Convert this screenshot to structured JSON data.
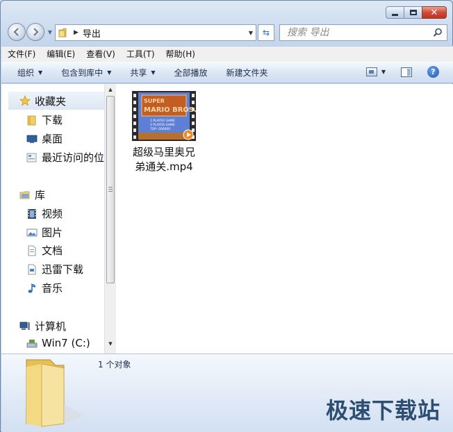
{
  "window": {
    "caption": {
      "minimize": "–",
      "maximize": "",
      "close": "✕"
    }
  },
  "address": {
    "path": "导出",
    "refresh_icon": "refresh-icon"
  },
  "search": {
    "placeholder": "搜索 导出"
  },
  "menu": {
    "items": [
      "文件(F)",
      "编辑(E)",
      "查看(V)",
      "工具(T)",
      "帮助(H)"
    ]
  },
  "commands": {
    "organize": "组织",
    "include_library": "包含到库中",
    "share": "共享",
    "play_all": "全部播放",
    "new_folder": "新建文件夹",
    "help": "?"
  },
  "nav": {
    "favorites": "收藏夹",
    "downloads": "下载",
    "desktop": "桌面",
    "recent": "最近访问的位置",
    "libraries": "库",
    "videos": "视频",
    "pictures": "图片",
    "documents": "文档",
    "thunder": "迅雷下载",
    "music": "音乐",
    "computer": "计算机",
    "drive_c": "Win7 (C:)"
  },
  "files": [
    {
      "name": "超级马里奥兄弟通关.mp4",
      "thumb_title_line1": "SUPER",
      "thumb_title_line2": "MARIO BROS.",
      "thumb_lines": [
        "1 PLAYER GAME",
        "2 PLAYER GAME",
        "TOP- 000000"
      ]
    }
  ],
  "details": {
    "count": "1 个对象"
  },
  "watermark": "极速下载站",
  "colors": {
    "accent": "#2c6ec0",
    "close_red": "#cf4a35",
    "folder_yellow": "#f2cf62"
  }
}
